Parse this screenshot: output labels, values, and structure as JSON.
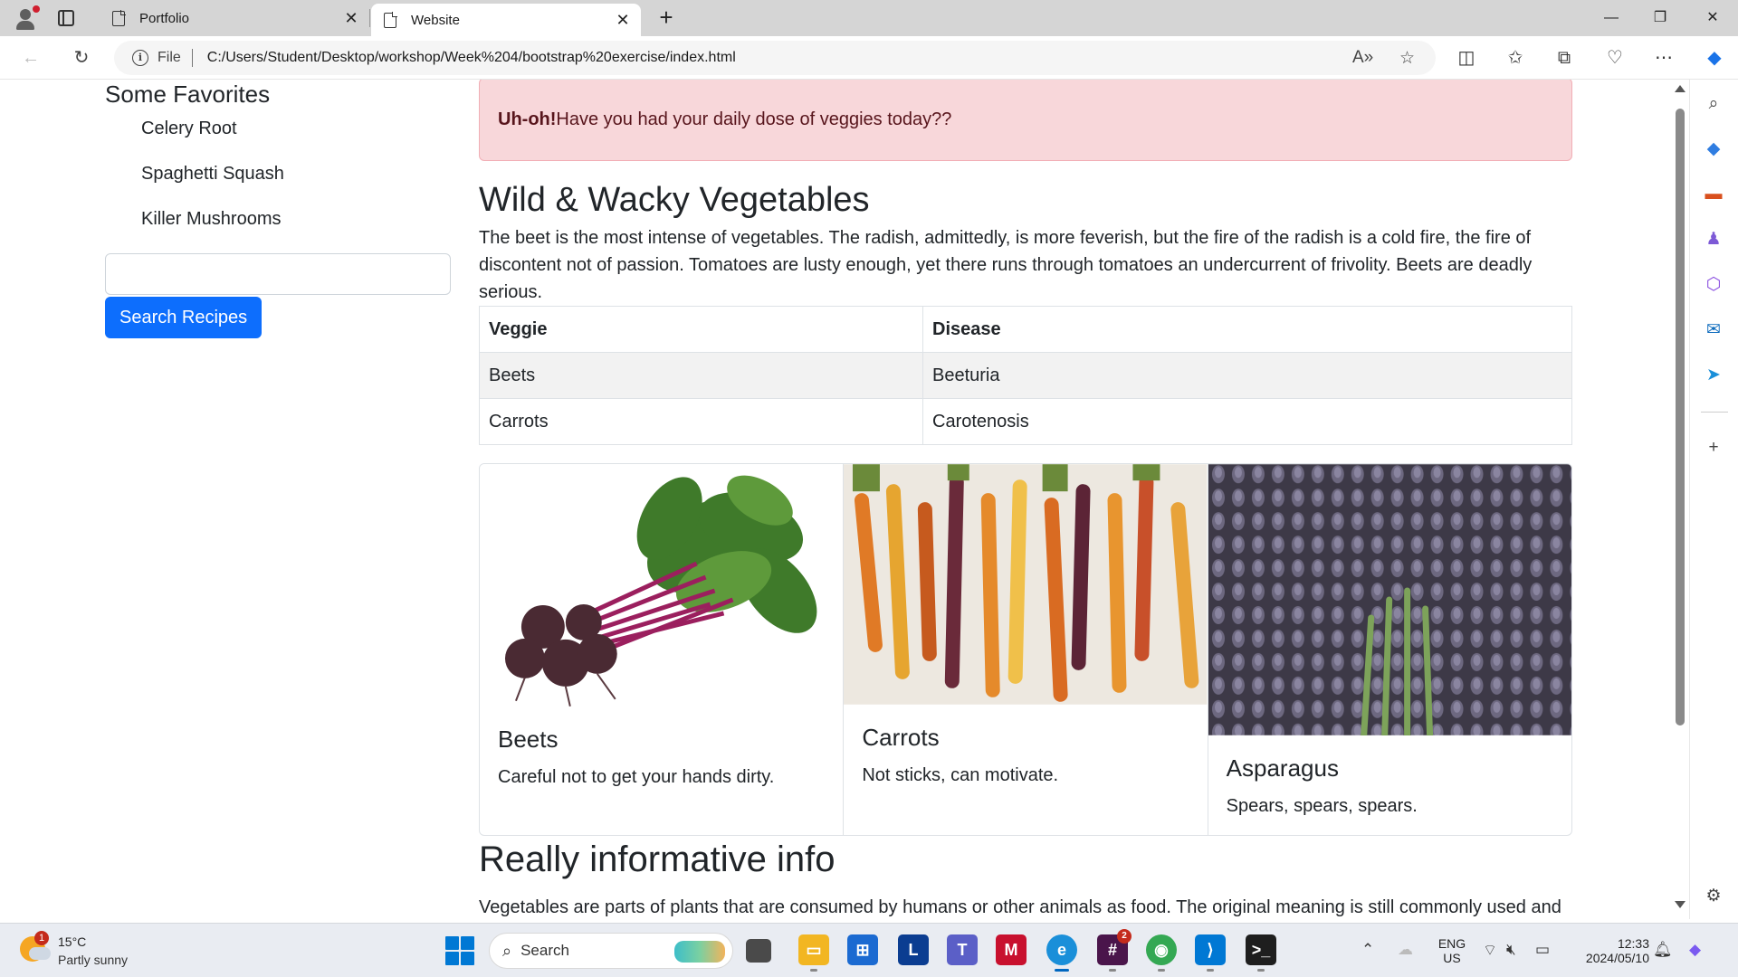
{
  "browser": {
    "tabs": [
      {
        "title": "Portfolio",
        "active": false
      },
      {
        "title": "Website",
        "active": true
      }
    ],
    "address": {
      "scheme_label": "File",
      "url": "C:/Users/Student/Desktop/workshop/Week%204/bootstrap%20exercise/index.html"
    },
    "window_controls": {
      "minimize": "—",
      "maximize": "❐",
      "close": "✕"
    }
  },
  "page": {
    "sidebar": {
      "title": "Some Favorites",
      "items": [
        "Celery Root",
        "Spaghetti Squash",
        "Killer Mushrooms"
      ],
      "search_value": "",
      "search_button": "Search Recipes"
    },
    "alert": {
      "strong": "Uh-oh!",
      "text": "Have you had your daily dose of veggies today??"
    },
    "section1": {
      "heading": "Wild & Wacky Vegetables",
      "paragraph": "The beet is the most intense of vegetables. The radish, admittedly, is more feverish, but the fire of the radish is a cold fire, the fire of discontent not of passion. Tomatoes are lusty enough, yet there runs through tomatoes an undercurrent of frivolity. Beets are deadly serious."
    },
    "table": {
      "headers": [
        "Veggie",
        "Disease"
      ],
      "rows": [
        [
          "Beets",
          "Beeturia"
        ],
        [
          "Carrots",
          "Carotenosis"
        ]
      ]
    },
    "cards": [
      {
        "title": "Beets",
        "text": "Careful not to get your hands dirty.",
        "image": "beets-photo"
      },
      {
        "title": "Carrots",
        "text": "Not sticks, can motivate.",
        "image": "carrots-photo"
      },
      {
        "title": "Asparagus",
        "text": "Spears, spears, spears.",
        "image": "asparagus-photo"
      }
    ],
    "section2": {
      "heading": "Really informative info",
      "paragraph": "Vegetables are parts of plants that are consumed by humans or other animals as food. The original meaning is still commonly used and"
    }
  },
  "taskbar": {
    "weather": {
      "temp": "15°C",
      "condition": "Partly sunny",
      "badge": "1"
    },
    "search_placeholder": "Search",
    "language": {
      "line1": "ENG",
      "line2": "US"
    },
    "clock": {
      "time": "12:33",
      "date": "2024/05/10"
    },
    "slack_badge": "2"
  },
  "colors": {
    "primary": "#0d6efd",
    "alert_bg": "#f8d7da",
    "alert_text": "#58151c"
  }
}
